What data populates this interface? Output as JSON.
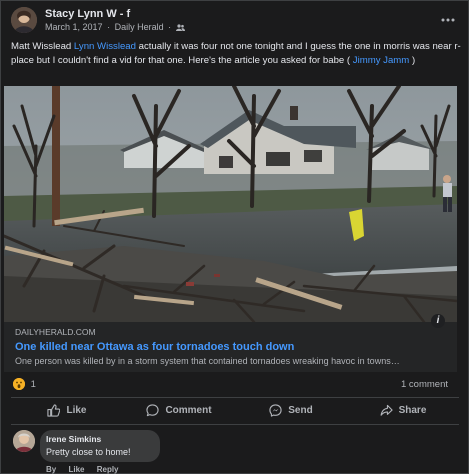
{
  "post": {
    "author": "Stacy Lynn W - f",
    "date": "March 1, 2017",
    "source": "Daily Herald",
    "separator": "·",
    "more_icon": "more-horizontal-icon",
    "audience_icon": "friends-icon",
    "text_parts": [
      "Matt Wisslead ",
      "Lynn Wisslead",
      "  actually it was four not one tonight and I guess the one in morris was near r-place but I couldn't find a vid for that one.  Here's the article you asked for babe ( ",
      "Jimmy Jamm",
      " )"
    ]
  },
  "link": {
    "domain": "DAILYHERALD.COM",
    "title": "One killed near Ottawa as four tornadoes touch down",
    "description": "One person was killed by in a storm system that contained tornadoes wreaking havoc in towns…",
    "info_label": "i"
  },
  "stats": {
    "reaction_count": "1",
    "comment_count": "1 comment",
    "reaction_icon": "wow-reaction-icon"
  },
  "actions": {
    "like": "Like",
    "comment": "Comment",
    "send": "Send",
    "share": "Share"
  },
  "comment": {
    "name": "Irene Simkins",
    "text": "Pretty close to home!",
    "action_by": "By",
    "action_like": "Like",
    "action_reply": "Reply"
  },
  "colors": {
    "background": "#1b1b1c",
    "accent_link": "#4599ff",
    "text_primary": "#e4e6eb",
    "text_secondary": "#b0b3b8"
  }
}
